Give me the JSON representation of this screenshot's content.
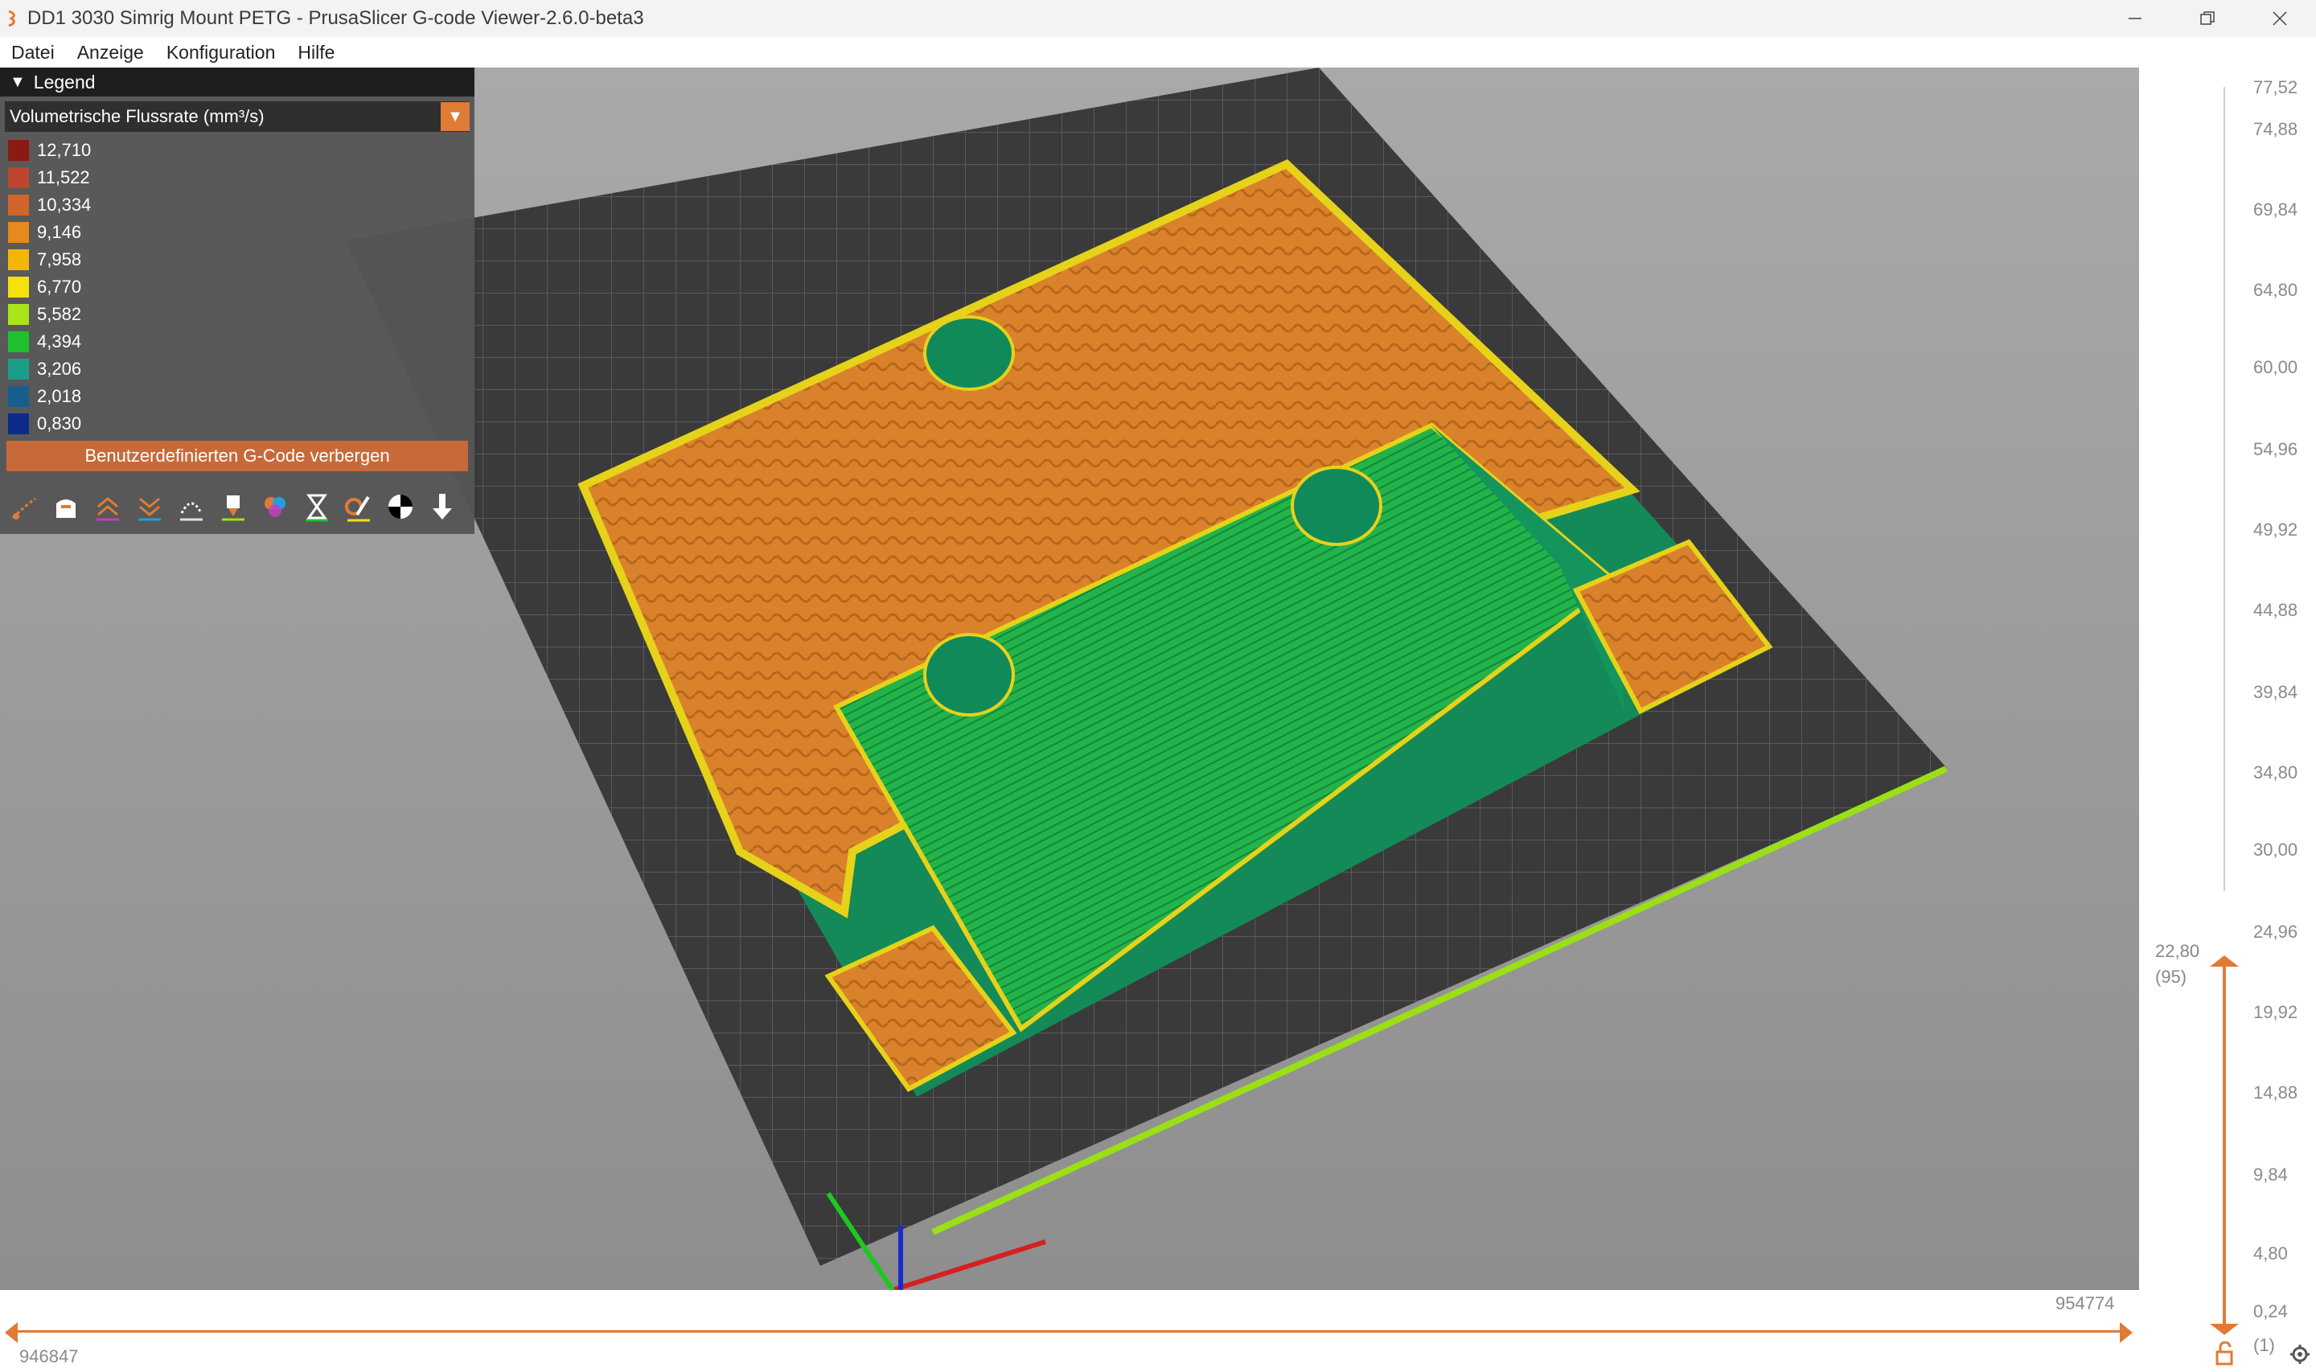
{
  "window": {
    "title": "DD1 3030 Simrig Mount PETG - PrusaSlicer G-code Viewer-2.6.0-beta3",
    "controls": [
      "minimize-icon",
      "restore-icon",
      "close-icon"
    ]
  },
  "menu": {
    "items": [
      "Datei",
      "Anzeige",
      "Konfiguration",
      "Hilfe"
    ]
  },
  "legend": {
    "title": "Legend",
    "selected_view": "Volumetrische Flussrate (mm³/s)",
    "entries": [
      {
        "value": "12,710",
        "color": "#8b1a10"
      },
      {
        "value": "11,522",
        "color": "#c0452f"
      },
      {
        "value": "10,334",
        "color": "#d1652a"
      },
      {
        "value": "9,146",
        "color": "#e68a1e"
      },
      {
        "value": "7,958",
        "color": "#f2b705"
      },
      {
        "value": "6,770",
        "color": "#f5e20a"
      },
      {
        "value": "5,582",
        "color": "#a8e61a"
      },
      {
        "value": "4,394",
        "color": "#20c030"
      },
      {
        "value": "3,206",
        "color": "#1a9e8a"
      },
      {
        "value": "2,018",
        "color": "#165f8c"
      },
      {
        "value": "0,830",
        "color": "#0c2a8a"
      }
    ],
    "hide_button": "Benutzerdefinierten G-Code verbergen",
    "toolbar_icons": [
      "travel-icon",
      "wipe-icon",
      "retractions-icon",
      "deretractions-icon",
      "seams-icon",
      "tool-changes-icon",
      "color-changes-icon",
      "pause-icon",
      "custom-gcode-icon",
      "center-of-gravity-icon",
      "shells-icon",
      "tool-marker-icon"
    ]
  },
  "layer_slider": {
    "ticks": [
      "77,52",
      "74,88",
      "69,84",
      "64,80",
      "60,00",
      "54,96",
      "49,92",
      "44,88",
      "39,84",
      "34,80",
      "30,00",
      "24,96",
      "19,92",
      "14,88",
      "9,84",
      "4,80",
      "0,24"
    ],
    "current_value": "22,80",
    "current_layer": "(95)",
    "min_layer": "(1)"
  },
  "move_slider": {
    "min": "946847",
    "max": "954774"
  },
  "colors": {
    "accent": "#e07b36",
    "infill": "#d9822b",
    "perimeter": "#20b06a",
    "bed": "#3c3c3c"
  }
}
